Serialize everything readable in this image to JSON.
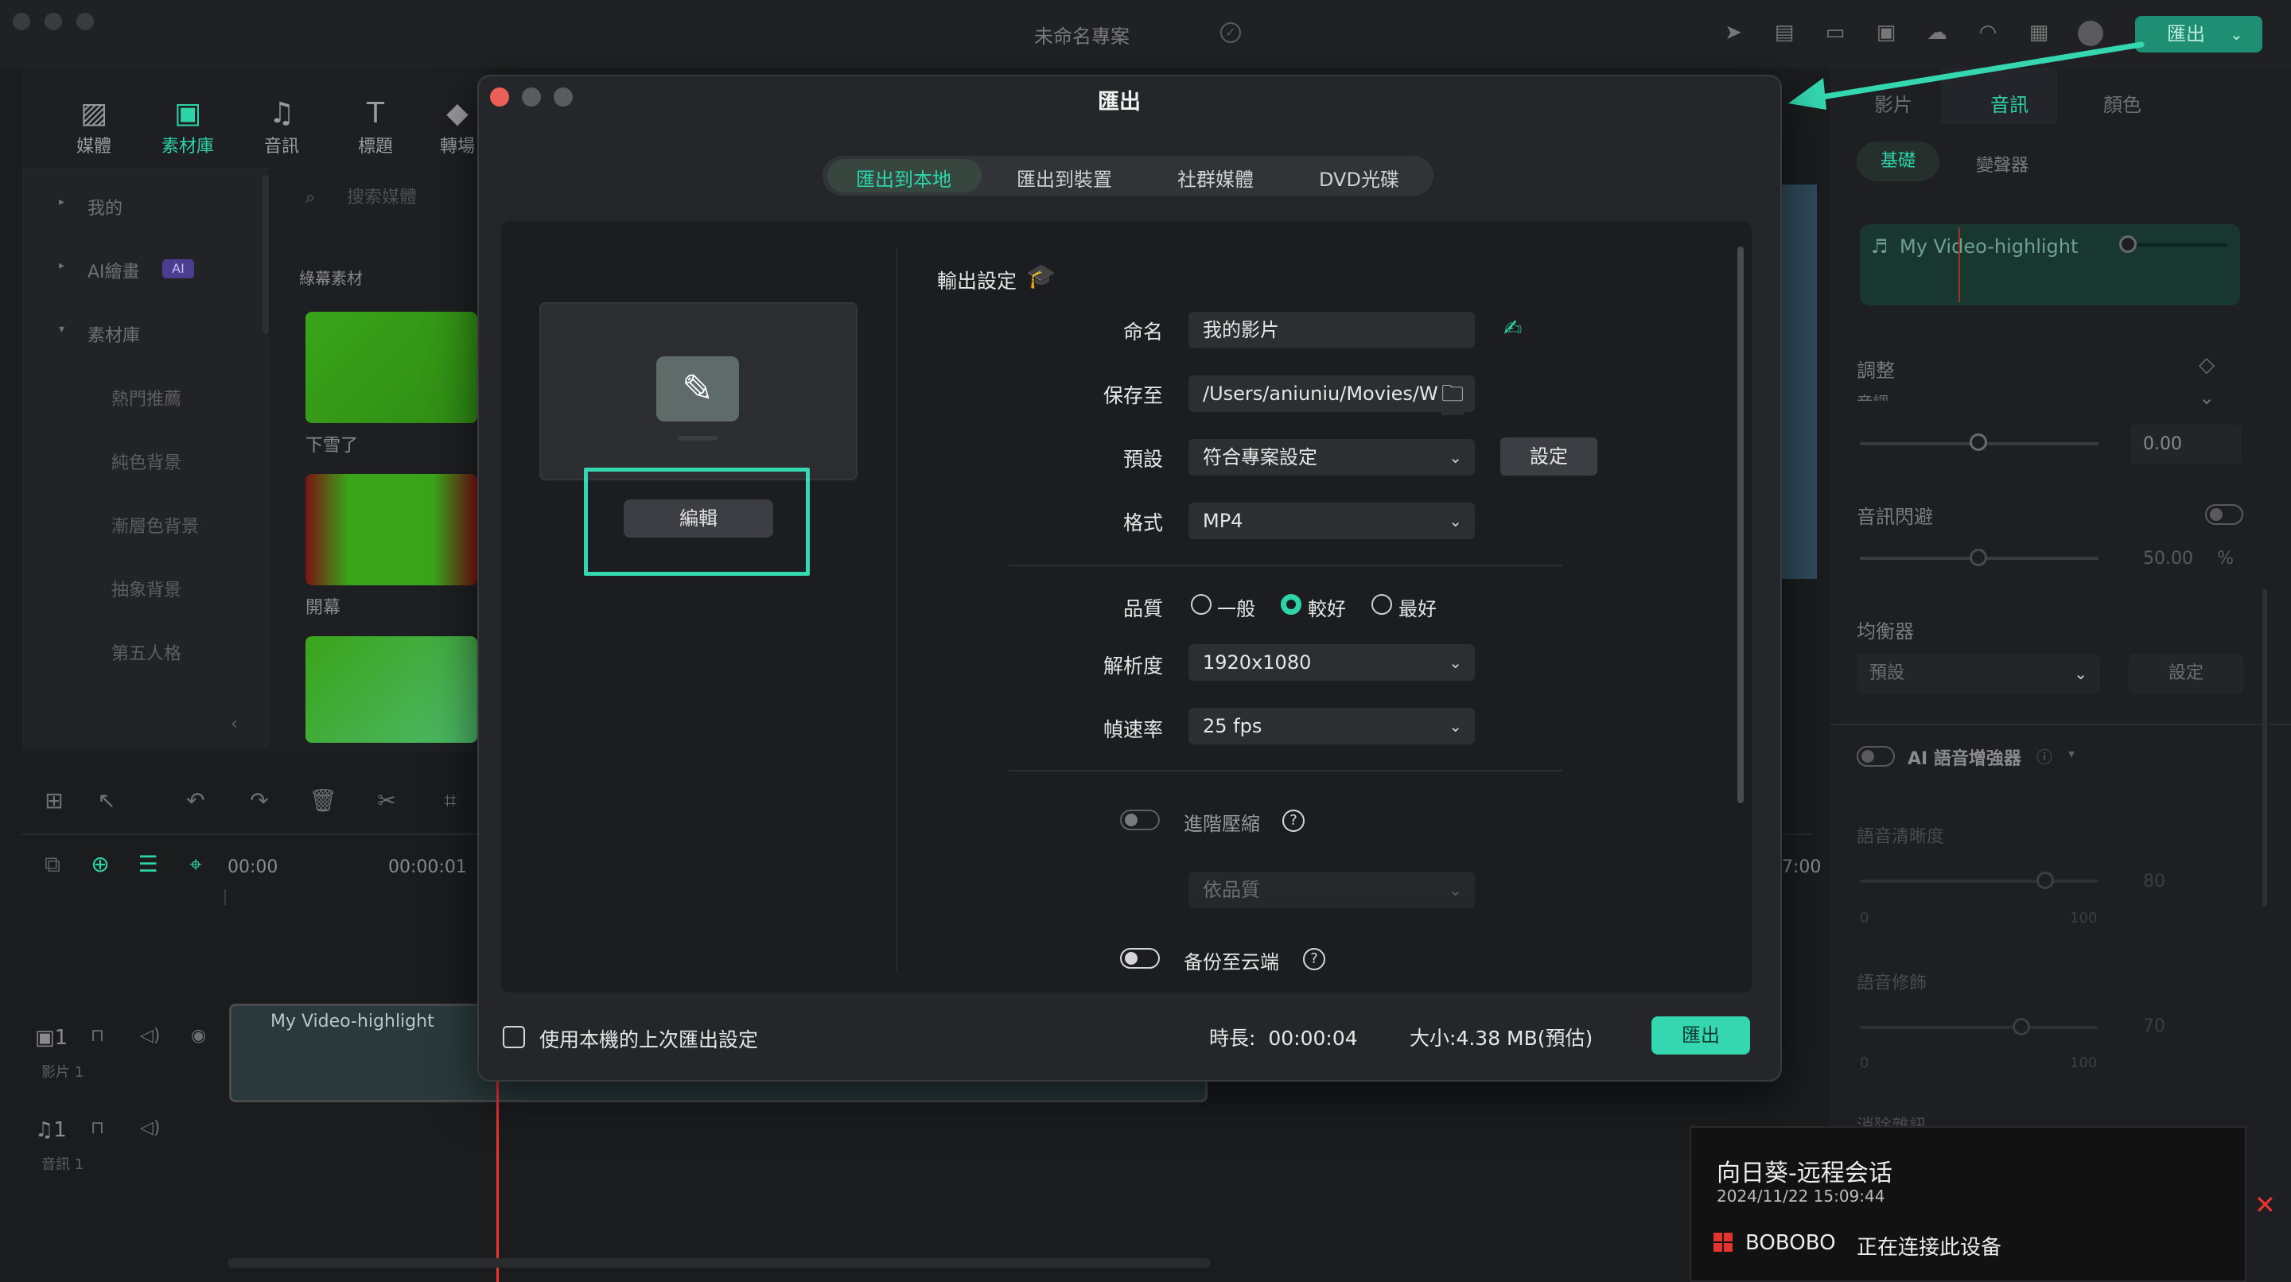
{
  "app": {
    "project_title": "未命名專案",
    "top_export_label": "匯出",
    "accent": "#2dd4a8"
  },
  "left_nav": {
    "tabs": [
      {
        "label": "媒體",
        "icon": "media-icon"
      },
      {
        "label": "素材庫",
        "icon": "library-icon"
      },
      {
        "label": "音訊",
        "icon": "music-icon"
      },
      {
        "label": "標題",
        "icon": "title-icon"
      },
      {
        "label": "轉場",
        "icon": "transition-icon"
      }
    ]
  },
  "library": {
    "tree": [
      "我的",
      "AI繪畫",
      "素材庫"
    ],
    "ai_badge": "AI",
    "subitems": [
      "熱門推薦",
      "純色背景",
      "漸層色背景",
      "抽象背景",
      "第五人格"
    ],
    "search_placeholder": "搜索媒體",
    "section_label": "綠幕素材",
    "thumbs": [
      "下雪了",
      "開幕"
    ]
  },
  "timeline": {
    "ruler": [
      "00:00",
      "00:00:01"
    ],
    "ruler_right": "7:00",
    "clip_name": "My Video-highlight",
    "track_video": "影片 1",
    "track_audio": "音訊 1"
  },
  "right_panel": {
    "tabs": [
      "影片",
      "音訊",
      "顏色"
    ],
    "subtabs": [
      "基礎",
      "變聲器"
    ],
    "audio_name": "My Video-highlight",
    "adjust": "調整",
    "adjust_sub": "音調",
    "pitch_value": "0.00",
    "ducking": "音訊閃避",
    "ducking_value": "50.00",
    "ducking_unit": "%",
    "eq": "均衡器",
    "eq_preset": "預設",
    "eq_set": "設定",
    "ai_enhancer": "AI 語音增強器",
    "clarity": "語音清晰度",
    "clarity_value": "80",
    "range_min": "0",
    "range_max": "100",
    "beauty": "語音修飾",
    "beauty_value": "70",
    "denoise": "消除雜訊"
  },
  "modal": {
    "title": "匯出",
    "tabs": [
      "匯出到本地",
      "匯出到裝置",
      "社群媒體",
      "DVD光碟"
    ],
    "edit_button": "編輯",
    "output_settings": "輸出設定",
    "fields": {
      "name_label": "命名",
      "name_value": "我的影片",
      "save_label": "保存至",
      "save_value": "/Users/aniuniu/Movies/W",
      "preset_label": "預設",
      "preset_value": "符合專案設定",
      "preset_button": "設定",
      "format_label": "格式",
      "format_value": "MP4",
      "quality_label": "品質",
      "quality_options": [
        "一般",
        "較好",
        "最好"
      ],
      "quality_selected": "較好",
      "resolution_label": "解析度",
      "resolution_value": "1920x1080",
      "fps_label": "幀速率",
      "fps_value": "25 fps",
      "advanced_label": "進階壓縮",
      "advanced_value": "依品質",
      "backup_label": "备份至云端"
    },
    "footer": {
      "checkbox_label": "使用本機的上次匯出設定",
      "duration_label": "時長:",
      "duration_value": "00:00:04",
      "size_label": "大小:",
      "size_value": "4.38 MB(預估)",
      "export_button": "匯出"
    }
  },
  "notification": {
    "title": "向日葵-远程会话",
    "time": "2024/11/22 15:09:44",
    "user": "BOBOBO",
    "message": "正在连接此设备"
  }
}
